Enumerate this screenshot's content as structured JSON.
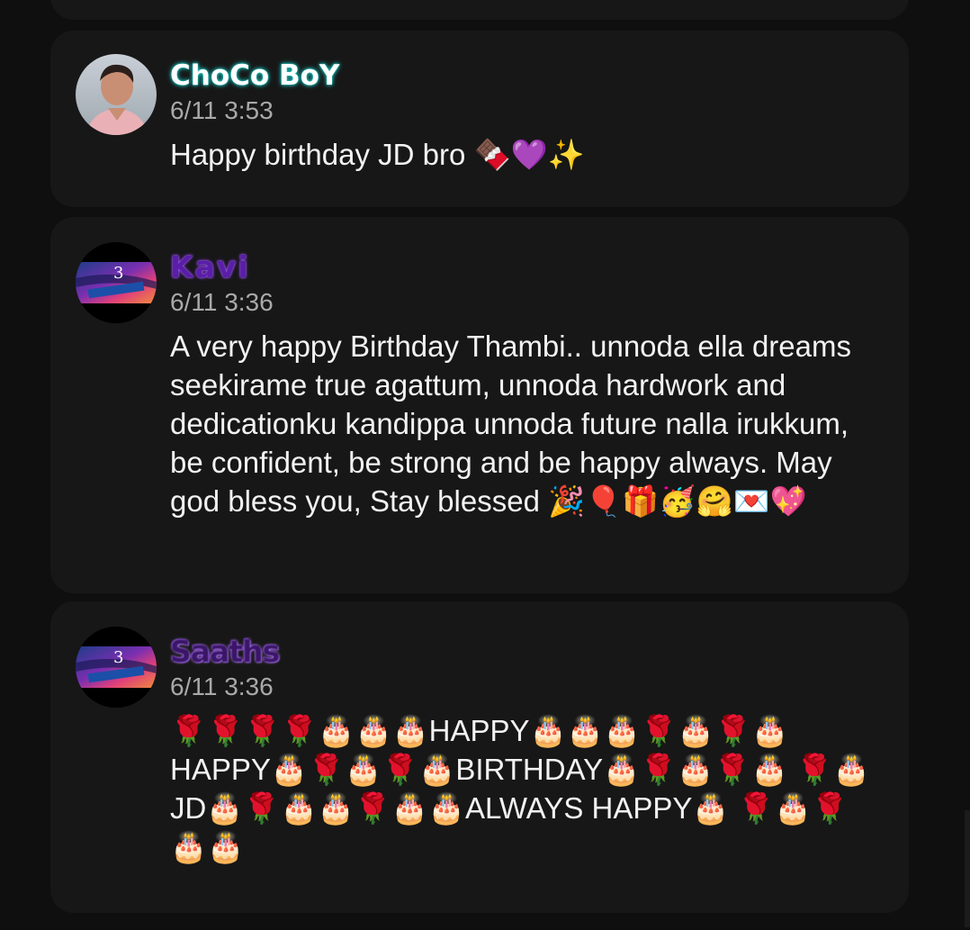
{
  "messages": [
    {
      "username": "ChoCo BoY",
      "timestamp": "6/11 3:53",
      "text": "Happy birthday JD bro 🍫💜✨"
    },
    {
      "username": "Kavi",
      "timestamp": "6/11 3:36",
      "text": "A very happy Birthday Thambi.. unnoda ella dreams seekirame true agattum, unnoda hardwork and dedicationku kandippa unnoda future nalla irukkum, be confident, be strong and be happy always. May god bless you, Stay blessed 🎉🎈🎁🥳🤗💌💖"
    },
    {
      "username": "Saaths",
      "timestamp": "6/11 3:36",
      "text": "🌹🌹🌹🌹🎂🎂🎂HAPPY🎂🎂🎂🌹🎂🌹🎂 HAPPY🎂🌹🎂🌹🎂BIRTHDAY🎂🌹🎂🌹🎂 🌹🎂JD🎂🌹🎂🎂🌹🎂🎂ALWAYS HAPPY🎂 🌹🎂🌹🎂🎂"
    }
  ],
  "avatars": [
    {
      "icon": "user-photo-avatar"
    },
    {
      "icon": "anniversary-badge-avatar",
      "badge_number": "3"
    },
    {
      "icon": "anniversary-badge-avatar",
      "badge_number": "3"
    }
  ]
}
